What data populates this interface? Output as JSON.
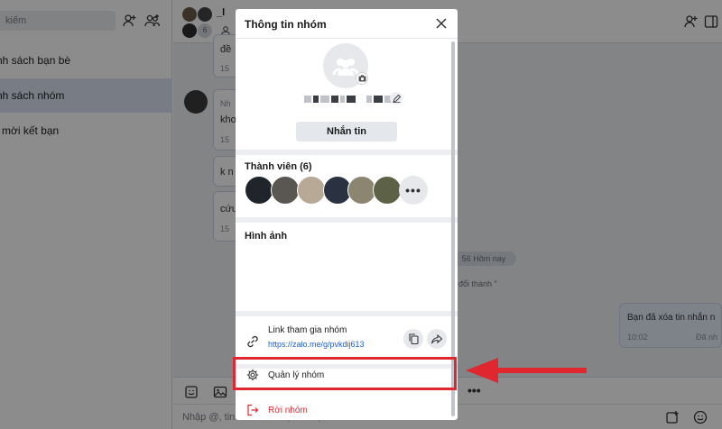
{
  "left_panel": {
    "search_placeholder": "kiếm",
    "items": [
      {
        "label": "nh sách bạn bè"
      },
      {
        "label": "nh sách nhóm"
      },
      {
        "label": "i mời kết bạn"
      }
    ]
  },
  "chat": {
    "header_title_partial": "_l",
    "member_count_badge": "6",
    "bubble_snippets": [
      "Nh",
      "đề",
      "kho",
      "k n",
      "cứu"
    ],
    "times": [
      "15",
      "15",
      "15",
      "15"
    ],
    "date_pill": "56 Hôm nay",
    "system_note": "đổi thành \"",
    "right_bubble_text": "Bạn đã xóa tin nhắn n",
    "right_bubble_time": "10:02",
    "right_bubble_status": "Đã nh",
    "composer_placeholder": "Nhập @, tin nhắn tới Điện Thoại Vui",
    "toolbar_more": "•••"
  },
  "modal": {
    "title": "Thông tin nhóm",
    "message_button": "Nhắn tin",
    "members_title": "Thành viên (6)",
    "more_members": "•••",
    "images_title": "Hình ảnh",
    "link_title": "Link tham gia nhóm",
    "link_url": "https://zalo.me/g/pvkdij613",
    "manage_label": "Quản lý nhóm",
    "leave_label": "Rời nhóm"
  },
  "colors": {
    "accent_red": "#e0262f",
    "link_blue": "#1b5fd1",
    "active_item": "#dbe4f3"
  }
}
